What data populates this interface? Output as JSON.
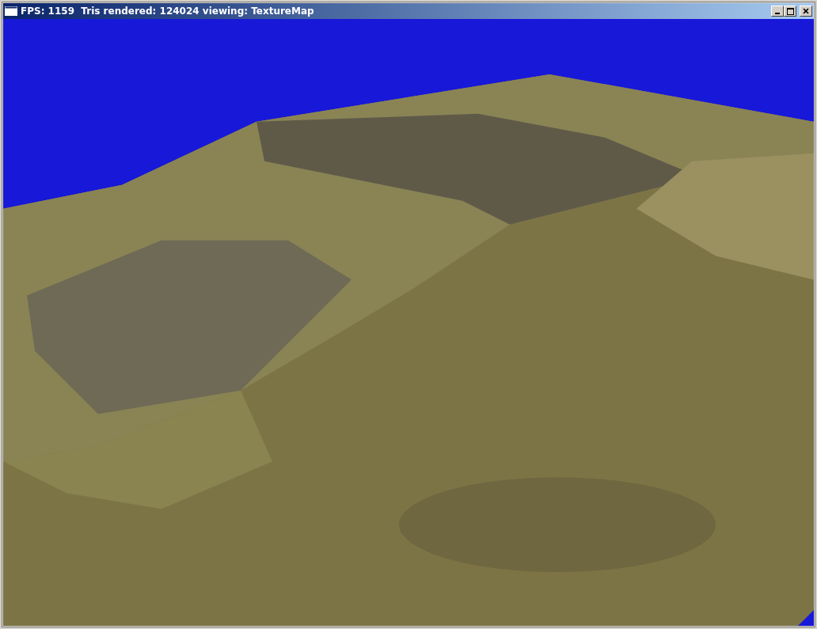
{
  "window": {
    "title": "FPS: 1159  Tris rendered: 124024 viewing: TextureMap"
  }
}
